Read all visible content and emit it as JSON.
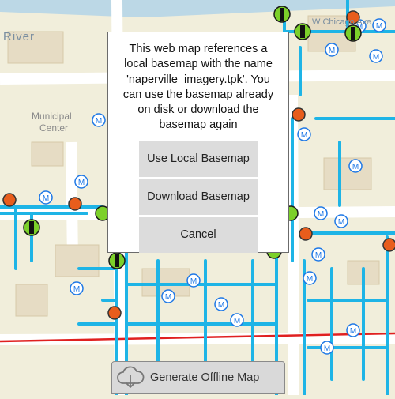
{
  "map": {
    "labels": {
      "river": "River",
      "municipal": "Municipal",
      "center": "Center",
      "street_top": "W Chicago Ave"
    },
    "colors": {
      "pipe": "#1eb4e6",
      "road": "#ffffff",
      "land": "#f1eedb",
      "building": "#e6dcc4",
      "river": "#bcd8e6",
      "boundary": "#e02020",
      "marker_ring": "#1e78e6"
    }
  },
  "alert": {
    "message": "This web map references a local basemap with the name 'naperville_imagery.tpk'. You can use the basemap already on disk or download the basemap again",
    "use_local_label": "Use Local Basemap",
    "download_label": "Download Basemap",
    "cancel_label": "Cancel"
  },
  "toolbar": {
    "generate_label": "Generate Offline Map",
    "generate_icon": "cloud-download-icon"
  }
}
